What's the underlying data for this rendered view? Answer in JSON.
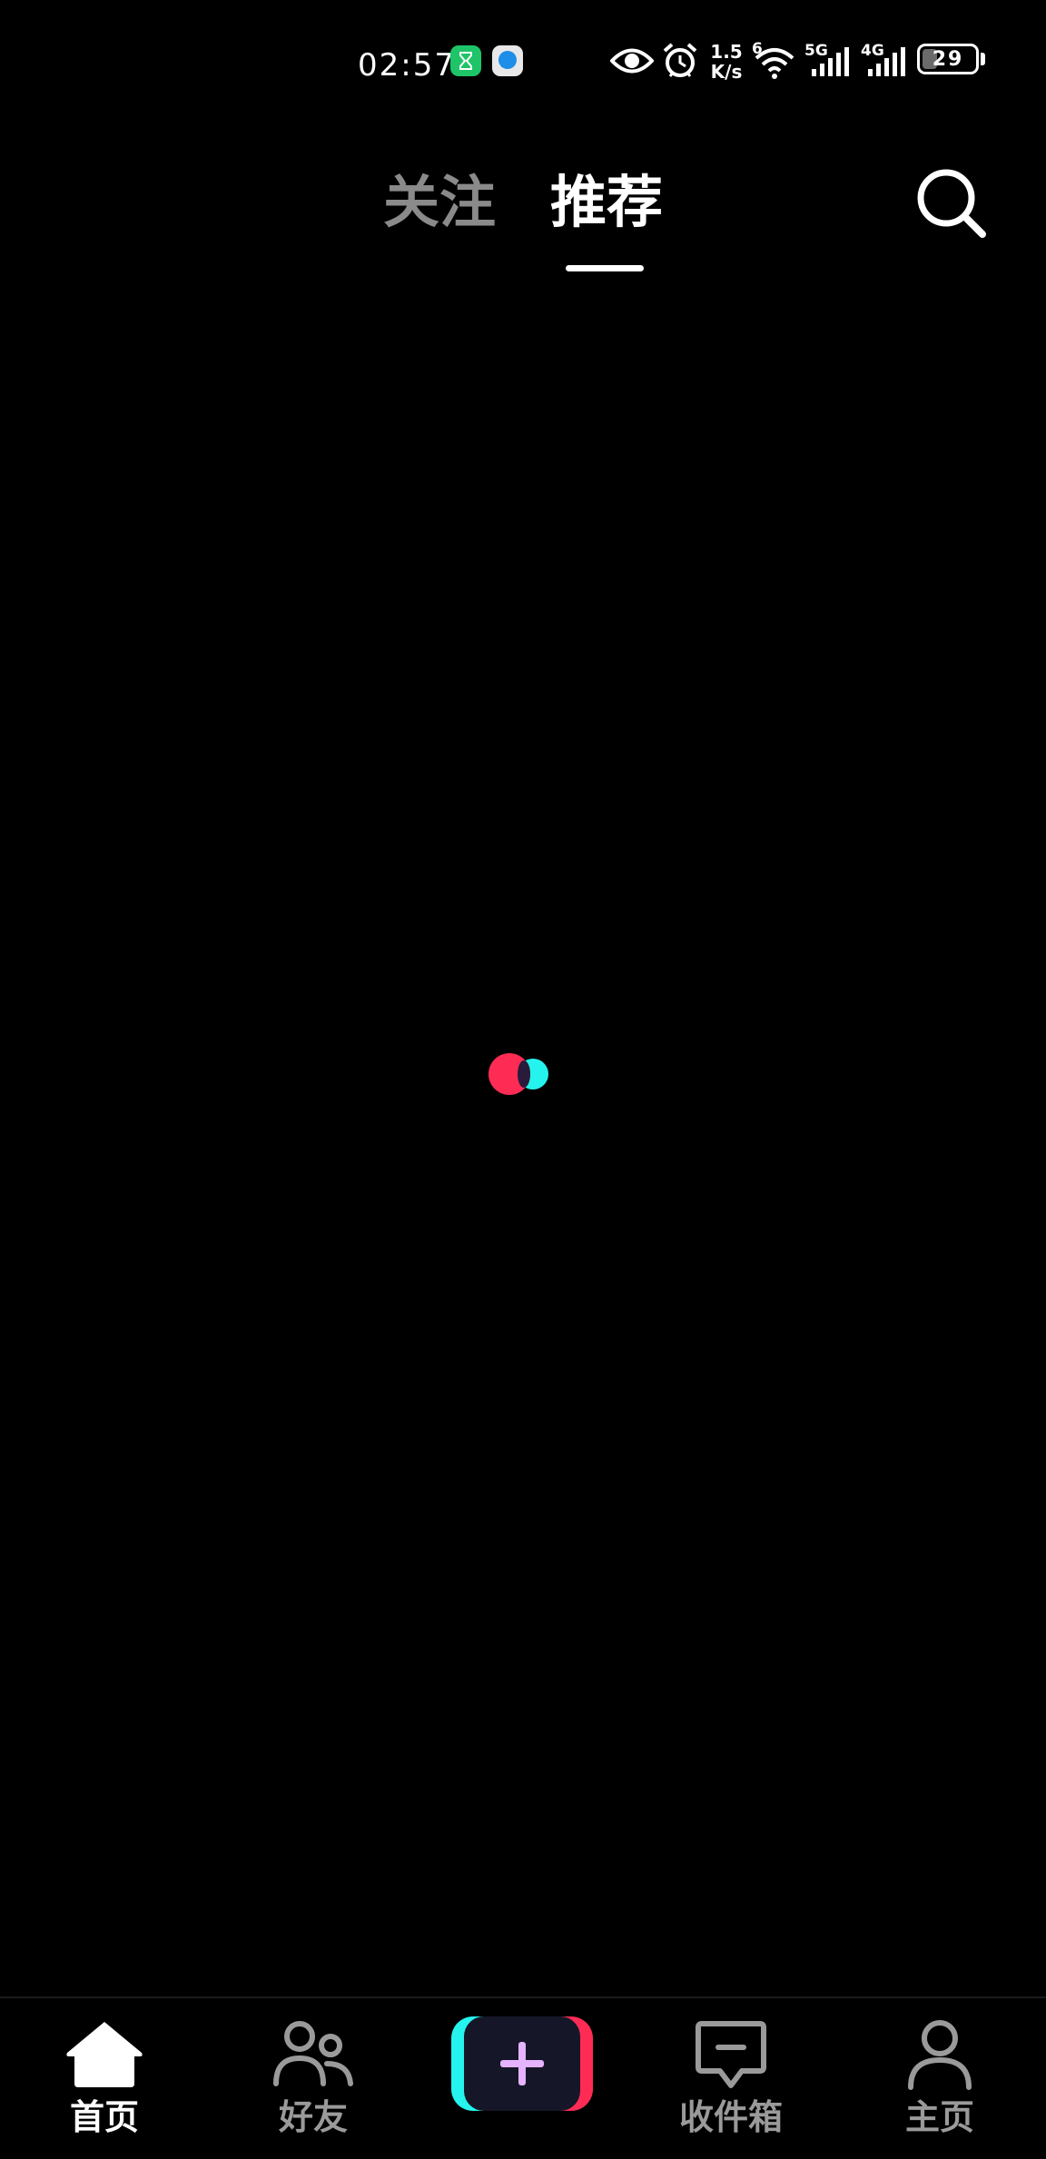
{
  "status_bar": {
    "time": "02:57",
    "net_speed_value": "1.5",
    "net_speed_unit": "K/s",
    "wifi_label": "6",
    "sim1_label": "5G",
    "sim2_label": "4G",
    "battery_level": "29",
    "notification_icons": [
      "hourglass-icon",
      "chat-bubble-icon"
    ],
    "system_icons": [
      "eye-icon",
      "alarm-icon",
      "wifi-icon",
      "signal-icon",
      "battery-icon"
    ]
  },
  "top_tabs": {
    "follow_label": "关注",
    "recommend_label": "推荐",
    "active": "recommend"
  },
  "search": {
    "icon": "search-icon"
  },
  "loader": {
    "colors": [
      "#fe2c55",
      "#25f4ee"
    ]
  },
  "bottom_nav": {
    "home_label": "首页",
    "friends_label": "好友",
    "inbox_label": "收件箱",
    "profile_label": "主页",
    "active": "home",
    "create_icon": "plus-icon"
  },
  "colors": {
    "background": "#000000",
    "active_text": "#ffffff",
    "inactive_text": "#9a9a9a",
    "accent_red": "#fe2c55",
    "accent_cyan": "#25f4ee"
  }
}
